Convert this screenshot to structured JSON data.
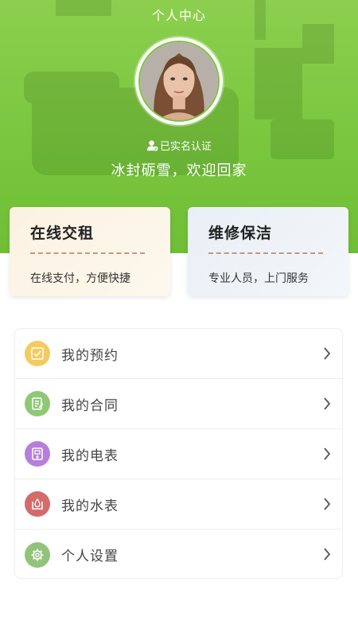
{
  "header": {
    "title": "个人中心",
    "verify_text": "已实名认证",
    "welcome": "冰封砺雪，欢迎回家"
  },
  "cards": {
    "rent": {
      "title": "在线交租",
      "desc": "在线支付，方便快捷"
    },
    "repair": {
      "title": "维修保洁",
      "desc": "专业人员，上门服务"
    }
  },
  "menu": {
    "items": [
      {
        "label": "我的预约",
        "icon": "checkbox-icon",
        "color": "#f4cb5c"
      },
      {
        "label": "我的合同",
        "icon": "contract-icon",
        "color": "#8fc874"
      },
      {
        "label": "我的电表",
        "icon": "meter-icon",
        "color": "#b67fdb"
      },
      {
        "label": "我的水表",
        "icon": "water-icon",
        "color": "#d46b6b"
      },
      {
        "label": "个人设置",
        "icon": "gear-icon",
        "color": "#91c47a"
      }
    ]
  },
  "colors": {
    "brand": "#7ac73f",
    "text": "#444444"
  }
}
